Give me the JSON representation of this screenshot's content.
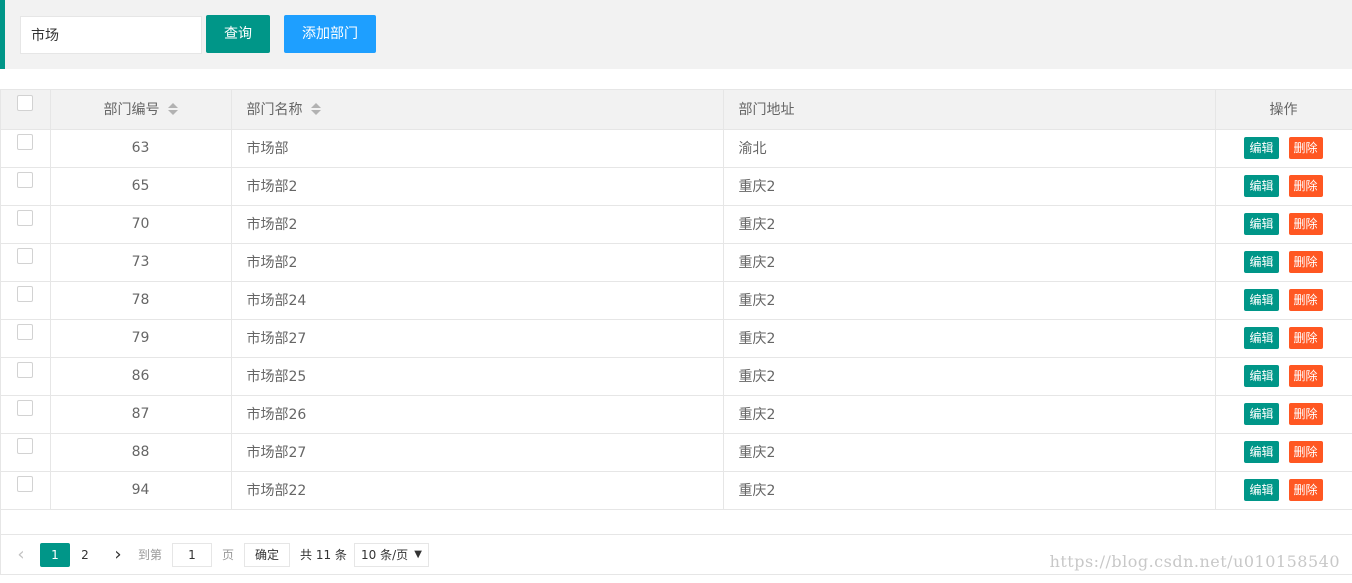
{
  "toolbar": {
    "search_value": "市场",
    "query_label": "查询",
    "add_label": "添加部门"
  },
  "table": {
    "headers": {
      "id": "部门编号",
      "name": "部门名称",
      "address": "部门地址",
      "actions": "操作"
    },
    "edit_label": "编辑",
    "delete_label": "删除",
    "rows": [
      {
        "id": "63",
        "name": "市场部",
        "address": "渝北"
      },
      {
        "id": "65",
        "name": "市场部2",
        "address": "重庆2"
      },
      {
        "id": "70",
        "name": "市场部2",
        "address": "重庆2"
      },
      {
        "id": "73",
        "name": "市场部2",
        "address": "重庆2"
      },
      {
        "id": "78",
        "name": "市场部24",
        "address": "重庆2"
      },
      {
        "id": "79",
        "name": "市场部27",
        "address": "重庆2"
      },
      {
        "id": "86",
        "name": "市场部25",
        "address": "重庆2"
      },
      {
        "id": "87",
        "name": "市场部26",
        "address": "重庆2"
      },
      {
        "id": "88",
        "name": "市场部27",
        "address": "重庆2"
      },
      {
        "id": "94",
        "name": "市场部22",
        "address": "重庆2"
      }
    ]
  },
  "pager": {
    "page_1": "1",
    "page_2": "2",
    "goto_label": "到第",
    "goto_value": "1",
    "page_label": "页",
    "confirm_label": "确定",
    "total_label": "共 11 条",
    "page_size": "10 条/页"
  },
  "colors": {
    "primary": "#009688",
    "normal": "#1e9fff",
    "danger": "#ff5722"
  },
  "watermark": "https://blog.csdn.net/u010158540"
}
